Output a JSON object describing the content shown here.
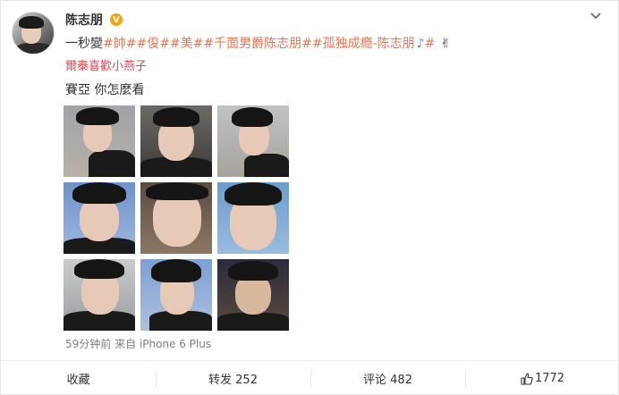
{
  "post": {
    "username": "陈志朋",
    "verified_badge": "V",
    "text_prefix": "一秒",
    "text_mid": "變",
    "hashtags": [
      "#帥##俊##美##千面男爵陈志朋##孤独成瘾-陈志朋",
      " #"
    ],
    "icons": [
      "avatar",
      "verified-badge-icon",
      "chevron-down-icon",
      "music-note-icon",
      "victory-hand-icon",
      "like-icon"
    ],
    "red_text": "爾泰喜歡小燕子",
    "second_line": "賽亞 你怎麼看",
    "time_source": "59分钟前 来自 iPhone 6 Plus",
    "image_count": 9
  },
  "actions": {
    "favorite": "收藏",
    "repost": "转发 252",
    "comment": "评论 482",
    "like_count": "1772"
  },
  "colors": {
    "tag": "#eb7350",
    "red_text": "#e0474c",
    "badge": "#f7a10b",
    "meta_gray": "#808080"
  }
}
